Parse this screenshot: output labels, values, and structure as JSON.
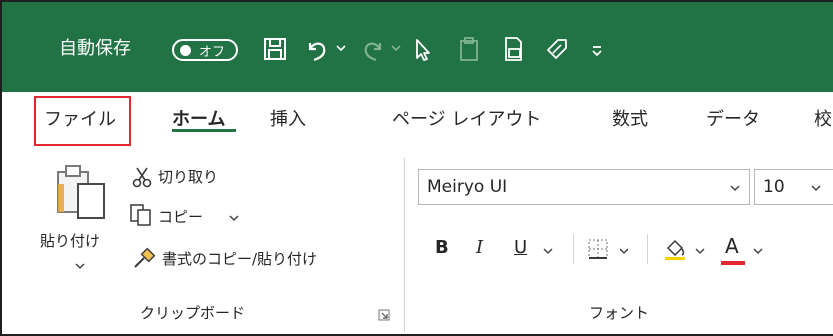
{
  "title_bar": {
    "autosave_label": "自動保存",
    "autosave_state": "オフ"
  },
  "tabs": [
    {
      "label": "ファイル"
    },
    {
      "label": "ホーム"
    },
    {
      "label": "挿入"
    },
    {
      "label": "ページ レイアウト"
    },
    {
      "label": "数式"
    },
    {
      "label": "データ"
    },
    {
      "label": "校"
    }
  ],
  "clipboard": {
    "paste_label": "貼り付け",
    "cut_label": "切り取り",
    "copy_label": "コピー",
    "format_painter_label": "書式のコピー/貼り付け",
    "group_label": "クリップボード"
  },
  "font": {
    "font_name": "Meiryo UI",
    "font_size": "10",
    "bold_label": "B",
    "italic_label": "I",
    "underline_label": "U",
    "font_color_label": "A",
    "group_label": "フォント"
  },
  "colors": {
    "title_bar": "#217346",
    "highlight_box": "#e3262f",
    "font_color_bar": "#e3262f"
  }
}
